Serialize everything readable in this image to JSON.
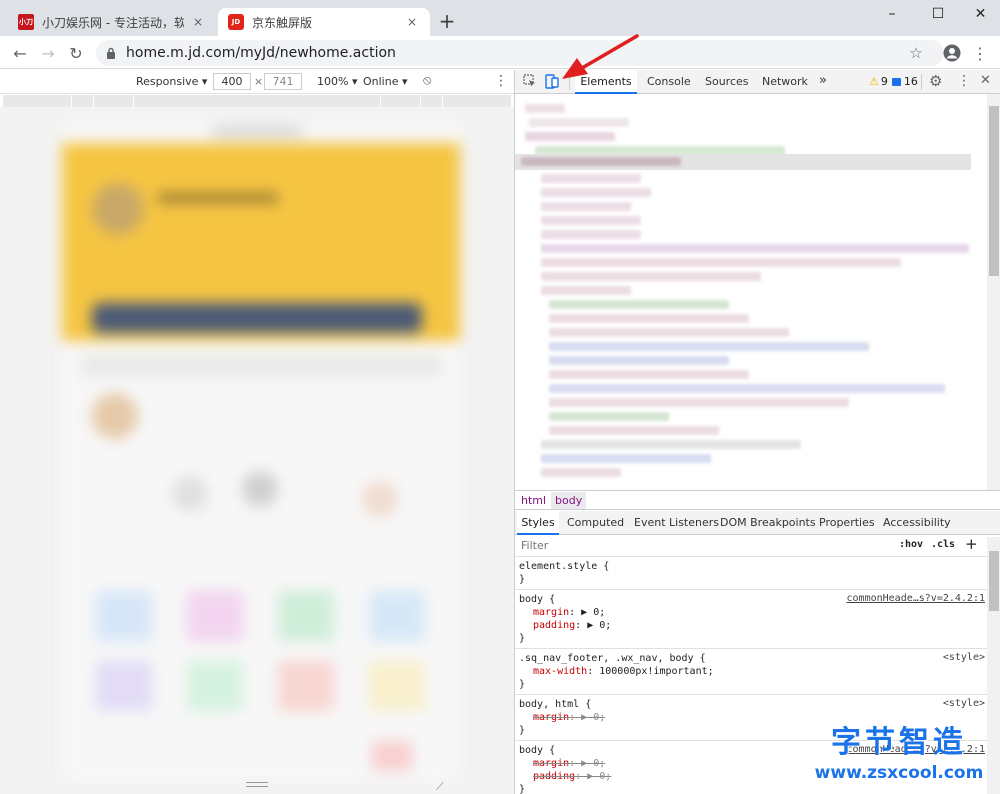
{
  "browser": {
    "tabs": [
      {
        "title": "小刀娱乐网 - 专注活动，软件，",
        "close": "×",
        "favicon": "小刀"
      },
      {
        "title": "京东触屏版",
        "close": "×",
        "favicon": "JD"
      }
    ],
    "new_tab": "+",
    "window": {
      "minimize": "–",
      "maximize": "☐",
      "close": "✕"
    },
    "url": "home.m.jd.com/myJd/newhome.action"
  },
  "device_toolbar": {
    "mode": "Responsive",
    "width": "400",
    "times": "×",
    "height": "741",
    "zoom": "100%",
    "network": "Online"
  },
  "devtools": {
    "tabs": [
      "Elements",
      "Console",
      "Sources",
      "Network"
    ],
    "more": "»",
    "warnings": "9",
    "messages": "16",
    "breadcrumbs": [
      "html",
      "body"
    ],
    "subtabs": [
      "Styles",
      "Computed",
      "Event Listeners",
      "DOM Breakpoints",
      "Properties",
      "Accessibility"
    ],
    "filter_placeholder": "Filter",
    "hov": ":hov",
    "cls": ".cls",
    "add": "+",
    "rules": [
      {
        "selector": "element.style {",
        "close": "}",
        "source": "",
        "props": []
      },
      {
        "selector": "body {",
        "close": "}",
        "source": "commonHeade…s?v=2.4.2:1",
        "props": [
          {
            "name": "margin",
            "value": "▶ 0;",
            "struck": false
          },
          {
            "name": "padding",
            "value": "▶ 0;",
            "struck": false
          }
        ]
      },
      {
        "selector": ".sq_nav_footer, .wx_nav, body {",
        "close": "}",
        "source": "<style>",
        "props": [
          {
            "name": "max-width",
            "value": "100000px!important;",
            "struck": false
          }
        ]
      },
      {
        "selector": "body, html {",
        "close": "}",
        "source": "<style>",
        "props": [
          {
            "name": "margin",
            "value": "▶ 0;",
            "struck": true
          }
        ]
      },
      {
        "selector": "body {",
        "close": "}",
        "source": "commonHeade…s?v=2.4.2:1",
        "props": [
          {
            "name": "margin",
            "value": "▶ 0;",
            "struck": true
          },
          {
            "name": "padding",
            "value": "▶ 0;",
            "struck": true
          }
        ]
      }
    ]
  },
  "watermark": {
    "line1": "字节智造",
    "line2": "www.zsxcool.com"
  },
  "colors": {
    "accent": "#1a73e8",
    "arrow": "#e02020",
    "jd_red": "#e1251b"
  }
}
